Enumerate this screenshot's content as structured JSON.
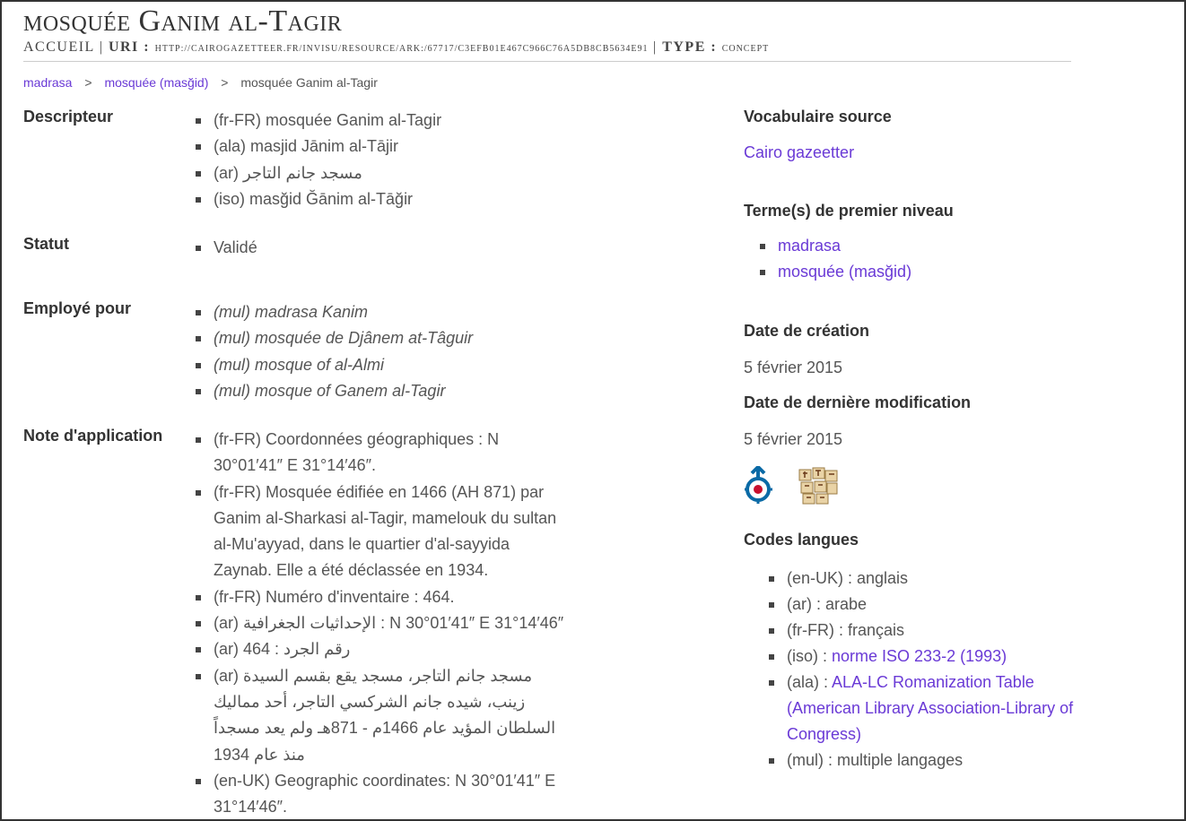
{
  "header": {
    "title": "mosquée Ganim al-Tagir",
    "accueil": "Accueil",
    "uri_label": "URI :",
    "uri_value": "http://cairogazetteer.fr/invisu/resource/ark:/67717/C3EFB01E467C966C76A5DB8CB5634E91",
    "type_label": "TYPE :",
    "type_value": "concept"
  },
  "breadcrumb": {
    "items": [
      "madrasa",
      "mosquée (masğid)"
    ],
    "current": "mosquée Ganim al-Tagir",
    "separator": ">"
  },
  "descripteur": {
    "label": "Descripteur",
    "items": [
      "(fr-FR) mosquée Ganim al-Tagir",
      "(ala) masjid Jānim al-Tājir",
      "(ar) مسجد جانم التاجر",
      "(iso) masğid Ğānim al-Tāğir"
    ]
  },
  "statut": {
    "label": "Statut",
    "items": [
      "Validé"
    ]
  },
  "employe": {
    "label": "Employé pour",
    "items": [
      "(mul) madrasa Kanim",
      "(mul) mosquée de Djânem at-Tâguir",
      "(mul) mosque of al-Almi",
      "(mul) mosque of Ganem al-Tagir"
    ]
  },
  "note": {
    "label": "Note d'application",
    "items": [
      "(fr-FR) Coordonnées géographiques : N 30°01′41″ E 31°14′46″.",
      "(fr-FR) Mosquée édifiée en 1466 (AH 871) par Ganim al-Sharkasi al-Tagir, mamelouk du sultan al-Mu'ayyad, dans le quartier d'al-sayyida Zaynab. Elle a été déclassée en 1934.",
      "(fr-FR) Numéro d'inventaire : 464.",
      "(ar) الإحداثيات الجغرافية : N 30°01′41″ E 31°14′46″",
      "(ar) رقم الجرد : 464",
      "(ar) مسجد جانم التاجر، مسجد يقع بقسم السيدة زينب، شيده جانم الشركسي التاجر، أحد مماليك السلطان المؤيد عام 1466م - 871هـ ولم يعد مسجداً منذ عام 1934",
      "(en-UK) Geographic coordinates: N 30°01′41″ E 31°14′46″."
    ]
  },
  "right": {
    "vocab_label": "Vocabulaire source",
    "vocab_value": "Cairo gazeetter",
    "terms_label": "Terme(s) de premier niveau",
    "terms": [
      "madrasa",
      "mosquée (masğid)"
    ],
    "creation_label": "Date de création",
    "creation_value": "5 février 2015",
    "modif_label": "Date de dernière modification",
    "modif_value": "5 février 2015",
    "codes_label": "Codes langues",
    "codes": [
      {
        "prefix": "(en-UK) : ",
        "text": "anglais",
        "link": false
      },
      {
        "prefix": "(ar) : ",
        "text": "arabe",
        "link": false
      },
      {
        "prefix": "(fr-FR) : ",
        "text": "français",
        "link": false
      },
      {
        "prefix": "(iso) : ",
        "text": "norme ISO 233-2 (1993)",
        "link": true
      },
      {
        "prefix": "(ala) : ",
        "text": "ALA-LC Romanization Table (American Library Association-Library of Congress)",
        "link": true
      },
      {
        "prefix": "(mul) : ",
        "text": "multiple langages",
        "link": false
      }
    ]
  },
  "icons": [
    "wikimedia-commons-icon",
    "glyph-tiles-icon"
  ],
  "colors": {
    "link": "#6a3ad6",
    "text": "#444444",
    "heading": "#333333"
  }
}
